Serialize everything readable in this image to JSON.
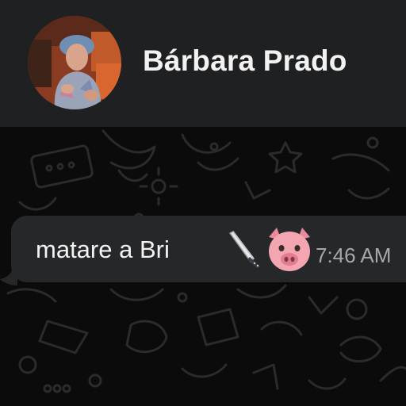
{
  "header": {
    "contact_name": "Bárbara Prado",
    "avatar_icon": "contact-avatar-photo"
  },
  "messages": [
    {
      "direction": "incoming",
      "text": "matare a Bri",
      "emojis": [
        "kitchen-knife-icon",
        "pig-face-icon"
      ],
      "time": "7:46 AM"
    }
  ],
  "colors": {
    "header_bg": "#1f2022",
    "wallpaper_bg": "#0b0b0c",
    "doodle_stroke": "#2a2b2d",
    "bubble_bg": "#262729",
    "text": "#f4f4f4",
    "timestamp": "#a7a8ab",
    "pig_pink": "#f3a5b1"
  }
}
